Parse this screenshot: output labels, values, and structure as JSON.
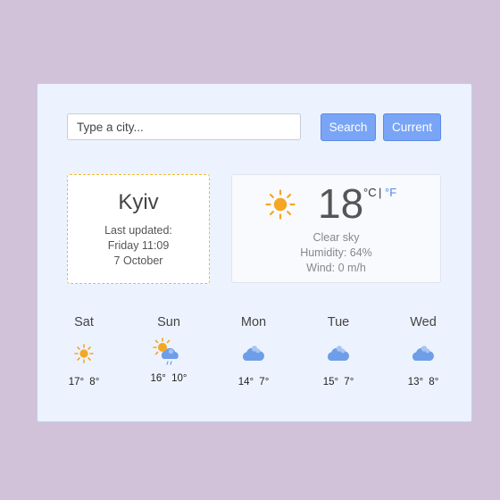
{
  "search": {
    "placeholder": "Type a city...",
    "search_label": "Search",
    "current_label": "Current"
  },
  "location": {
    "city": "Kyiv",
    "updated_label": "Last updated:",
    "updated_time": "Friday 11:09",
    "updated_date": "7 October"
  },
  "current": {
    "icon": "sun-icon",
    "temperature": "18",
    "unit_celsius": "°C",
    "unit_separator": "|",
    "unit_fahrenheit": "°F",
    "description": "Clear sky",
    "humidity": "Humidity: 64%",
    "wind": "Wind: 0 m/h"
  },
  "forecast": [
    {
      "day": "Sat",
      "icon": "sun-icon",
      "high": "17°",
      "low": "8°"
    },
    {
      "day": "Sun",
      "icon": "sun-cloud-rain-icon",
      "high": "16°",
      "low": "10°"
    },
    {
      "day": "Mon",
      "icon": "cloud-icon",
      "high": "14°",
      "low": "7°"
    },
    {
      "day": "Tue",
      "icon": "cloud-icon",
      "high": "15°",
      "low": "7°"
    },
    {
      "day": "Wed",
      "icon": "cloud-icon",
      "high": "13°",
      "low": "8°"
    }
  ],
  "colors": {
    "background": "#d1c2da",
    "panel": "#ecf3fe",
    "button": "#7aa5f6",
    "accent_border": "#f0b93a",
    "sun": "#f5a623",
    "cloud": "#6e9ee8"
  }
}
